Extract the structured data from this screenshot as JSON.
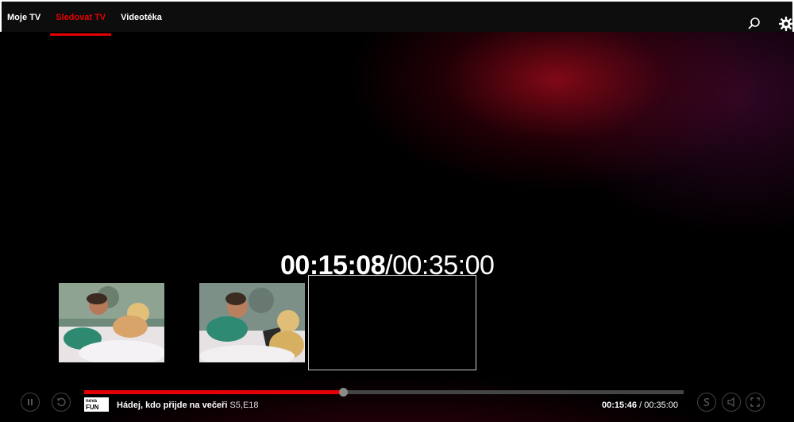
{
  "nav": {
    "tabs": [
      {
        "label": "Moje TV",
        "active": false
      },
      {
        "label": "Sledovat TV",
        "active": true
      },
      {
        "label": "Videotéka",
        "active": false
      }
    ],
    "icons": [
      "search-icon",
      "settings-gear-icon"
    ]
  },
  "seek": {
    "current": "00:15:08",
    "separator": "/",
    "total": "00:35:00"
  },
  "player": {
    "channel_logo": {
      "line1": "nova",
      "line2": "FUN"
    },
    "program_title": "Hádej, kdo přijde na večeři",
    "episode": "S5,E18",
    "position": "00:15:46",
    "separator": " / ",
    "duration": "00:35:00",
    "progress_fraction": 0.432,
    "buffer_fraction": 0.432,
    "left_controls": [
      "pause-icon",
      "restart-icon"
    ],
    "right_controls": [
      "subtitles-icon",
      "volume-icon",
      "fullscreen-icon"
    ]
  },
  "colors": {
    "accent": "#e60000",
    "background": "#000000"
  }
}
